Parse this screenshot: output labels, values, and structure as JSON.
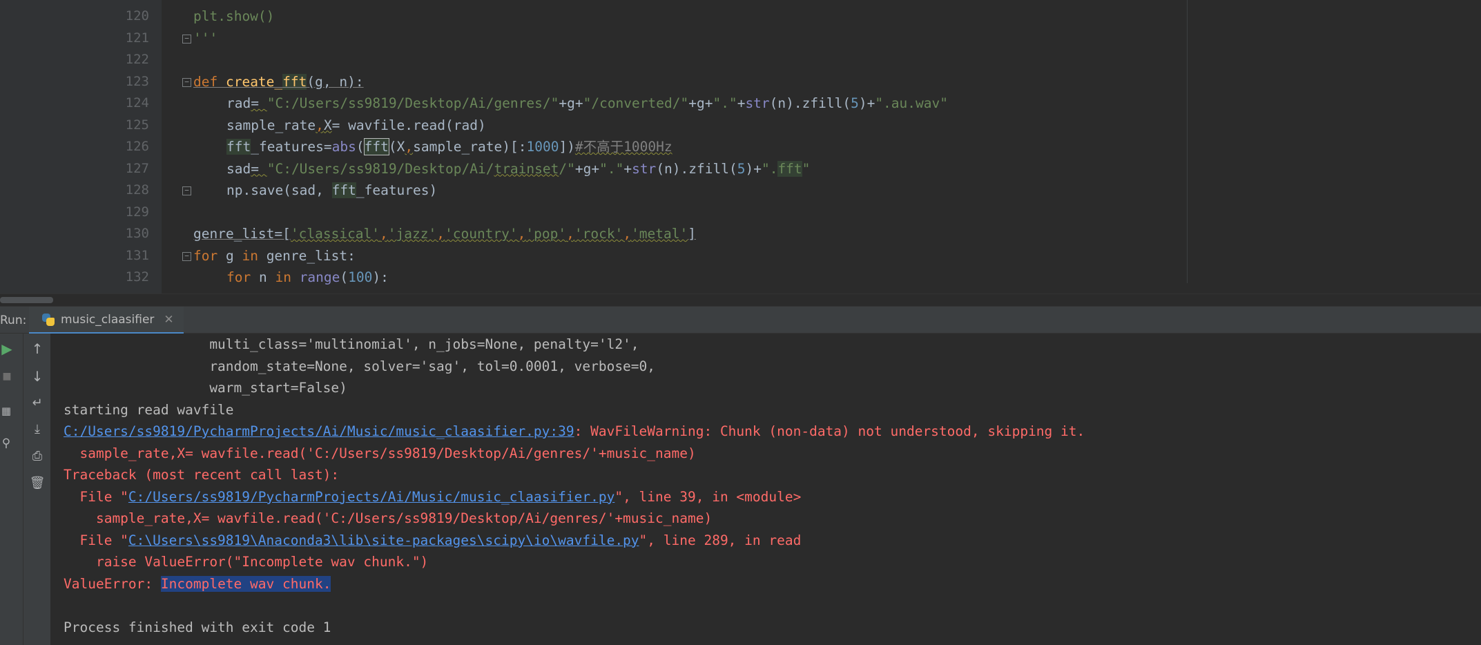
{
  "editor": {
    "line_numbers": [
      "120",
      "121",
      "122",
      "123",
      "124",
      "125",
      "126",
      "127",
      "128",
      "129",
      "130",
      "131",
      "132"
    ],
    "lines": {
      "l120": "plt.show()",
      "l121": "'''",
      "l123": {
        "kw": "def ",
        "fn_a": "create_",
        "fn_b": "fft",
        "params": "(g, n):"
      },
      "l124": {
        "a": "rad",
        "b": "= ",
        "s1": "\"C:/Users/ss9819/Desktop/Ai/genres/\"",
        "p1": "+g+",
        "s2": "\"/converted/\"",
        "p2": "+g+",
        "s3": "\".\"",
        "p3": "+",
        "bi": "str",
        "p4": "(n).zfill(",
        "n": "5",
        "p5": ")+",
        "s4": "\".au.wav\""
      },
      "l125": {
        "a": "sample_rate",
        "b": ",",
        "c": "X",
        "d": "= wavfile.read(rad)"
      },
      "l126": {
        "a": "fft",
        "b": "_features=",
        "bi": "abs",
        "c": "(",
        "d": "fft",
        "e": "(X",
        "f": ",",
        "g": "sample_rate)[:",
        "n": "1000",
        "h": "])",
        "cm": "#不高于1000Hz"
      },
      "l127": {
        "a": "sad",
        "b": "= ",
        "s1": "\"C:/Users/ss9819/Desktop/Ai/",
        "s1u": "trainset",
        "s1e": "/\"",
        "p1": "+g+",
        "s2": "\".\"",
        "p2": "+",
        "bi": "str",
        "p3": "(n).zfill(",
        "n": "5",
        "p4": ")+",
        "s3": "\".",
        "s3h": "fft",
        "s3e": "\""
      },
      "l128": {
        "a": "np.save(sad, ",
        "b": "fft",
        "c": "_features)"
      },
      "l130": {
        "a": "genre_list=[",
        "s1": "'classical'",
        "c1": ",",
        "s2": "'jazz'",
        "c2": ",",
        "s3": "'country'",
        "c3": ",",
        "s4": "'pop'",
        "c4": ",",
        "s5": "'rock'",
        "c5": ",",
        "s6": "'metal'",
        "e": "]"
      },
      "l131": {
        "kw": "for ",
        "a": "g ",
        "kw2": "in ",
        "b": "genre_list:"
      },
      "l132": {
        "kw": "for ",
        "a": "n ",
        "kw2": "in ",
        "bi": "range",
        "b": "(",
        "n": "100",
        "c": "):"
      }
    }
  },
  "run_panel": {
    "label": "Run:",
    "tab_label": "music_claasifier",
    "close_glyph": "✕"
  },
  "console": {
    "o1": "                  multi_class='multinomial', n_jobs=None, penalty='l2',",
    "o2": "                  random_state=None, solver='sag', tol=0.0001, verbose=0,",
    "o3": "                  warm_start=False)",
    "o4": "starting read wavfile",
    "o5_link": "C:/Users/ss9819/PycharmProjects/Ai/Music/music_claasifier.py:39",
    "o5_rest": ": WavFileWarning: Chunk (non-data) not understood, skipping it.",
    "o6": "  sample_rate,X= wavfile.read('C:/Users/ss9819/Desktop/Ai/genres/'+music_name)",
    "o7": "Traceback (most recent call last):",
    "o8_a": "  File \"",
    "o8_link": "C:/Users/ss9819/PycharmProjects/Ai/Music/music_claasifier.py",
    "o8_b": "\", line 39, in <module>",
    "o9": "    sample_rate,X= wavfile.read('C:/Users/ss9819/Desktop/Ai/genres/'+music_name)",
    "o10_a": "  File \"",
    "o10_link": "C:\\Users\\ss9819\\Anaconda3\\lib\\site-packages\\scipy\\io\\wavfile.py",
    "o10_b": "\", line 289, in read",
    "o11": "    raise ValueError(\"Incomplete wav chunk.\")",
    "o12_a": "ValueError: ",
    "o12_sel": "Incomplete wav chunk.",
    "o14": "Process finished with exit code 1"
  },
  "icons": [
    "run-icon",
    "stop-icon",
    "up-arrow-icon",
    "down-arrow-icon",
    "soft-wrap-icon",
    "scroll-to-end-icon",
    "print-icon",
    "trash-icon",
    "layout-icon",
    "pin-icon",
    "python-icon",
    "close-icon"
  ]
}
